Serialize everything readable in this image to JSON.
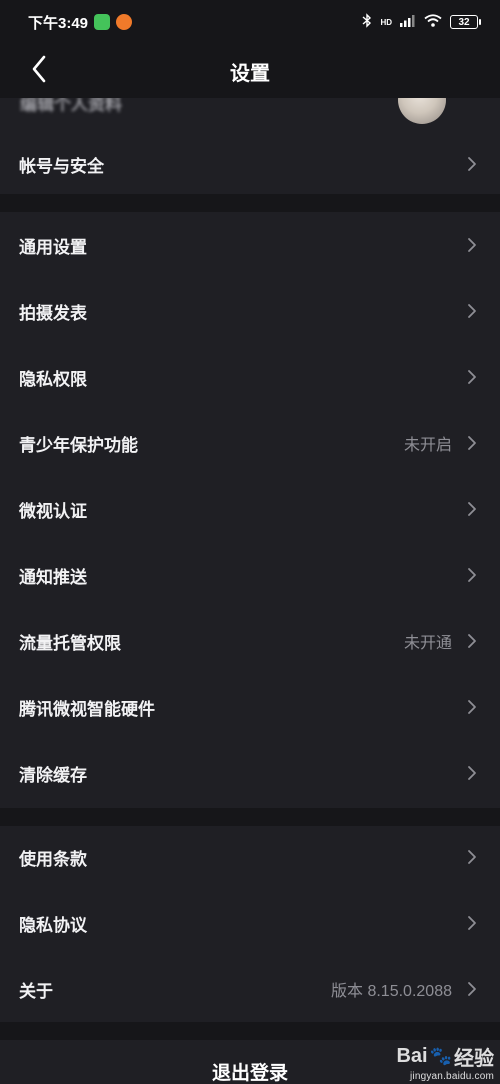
{
  "status_bar": {
    "time": "下午3:49",
    "network_label": "HD",
    "battery_level": "32",
    "icons": [
      "wechat-app-icon",
      "orange-app-icon",
      "bluetooth-icon",
      "signal-icon",
      "wifi-icon",
      "battery-icon"
    ]
  },
  "nav": {
    "title": "设置",
    "back_icon": "chevron-left-icon"
  },
  "partial_item": {
    "label": "编辑个人资料",
    "avatar": "avatar"
  },
  "section1": [
    {
      "label": "帐号与安全",
      "value": ""
    }
  ],
  "section2": [
    {
      "label": "通用设置",
      "value": ""
    },
    {
      "label": "拍摄发表",
      "value": ""
    },
    {
      "label": "隐私权限",
      "value": ""
    },
    {
      "label": "青少年保护功能",
      "value": "未开启"
    },
    {
      "label": "微视认证",
      "value": ""
    },
    {
      "label": "通知推送",
      "value": ""
    },
    {
      "label": "流量托管权限",
      "value": "未开通"
    },
    {
      "label": "腾讯微视智能硬件",
      "value": ""
    },
    {
      "label": "清除缓存",
      "value": ""
    }
  ],
  "section3": [
    {
      "label": "使用条款",
      "value": ""
    },
    {
      "label": "隐私协议",
      "value": ""
    },
    {
      "label": "关于",
      "value": "版本 8.15.0.2088"
    }
  ],
  "logout": {
    "label": "退出登录"
  },
  "watermark": {
    "brand": "Bai",
    "brand_suffix": "经验",
    "url": "jingyan.baidu.com"
  },
  "colors": {
    "background": "#161619",
    "card": "#1f1f24",
    "text": "#f2f2f4",
    "secondary_text": "#8e8e95",
    "chevron": "#8e8e95"
  }
}
